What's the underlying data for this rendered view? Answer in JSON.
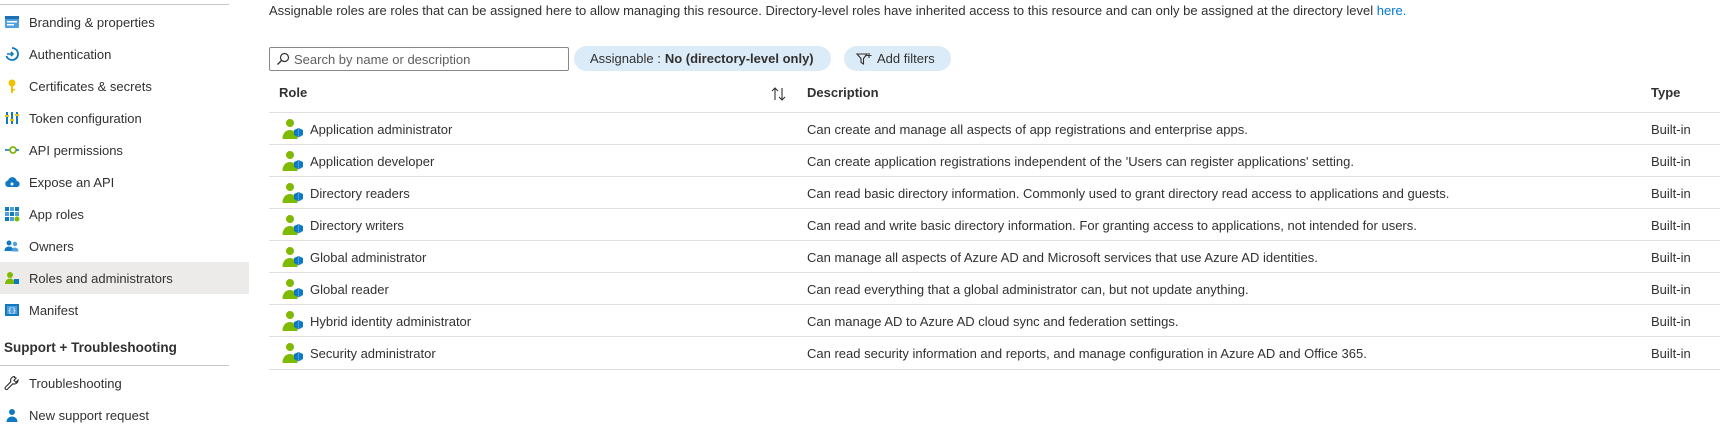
{
  "sidebar": {
    "items": [
      {
        "label": "Branding & properties",
        "icon": "branding-icon"
      },
      {
        "label": "Authentication",
        "icon": "authentication-icon"
      },
      {
        "label": "Certificates & secrets",
        "icon": "key-icon"
      },
      {
        "label": "Token configuration",
        "icon": "token-icon"
      },
      {
        "label": "API permissions",
        "icon": "api-permissions-icon"
      },
      {
        "label": "Expose an API",
        "icon": "cloud-icon"
      },
      {
        "label": "App roles",
        "icon": "app-roles-icon"
      },
      {
        "label": "Owners",
        "icon": "owners-icon"
      },
      {
        "label": "Roles and administrators",
        "icon": "roles-icon"
      },
      {
        "label": "Manifest",
        "icon": "manifest-icon"
      }
    ],
    "section_title": "Support + Troubleshooting",
    "support_items": [
      {
        "label": "Troubleshooting",
        "icon": "wrench-icon"
      },
      {
        "label": "New support request",
        "icon": "support-person-icon"
      }
    ],
    "active_index": 8
  },
  "intro": {
    "text": "Assignable roles are roles that can be assigned here to allow managing this resource. Directory-level roles have inherited access to this resource and can only be assigned at the directory level ",
    "link": "here."
  },
  "search": {
    "placeholder": "Search by name or description",
    "value": ""
  },
  "filter_pill": {
    "label": "Assignable :",
    "value": "No (directory-level only)"
  },
  "add_filters": {
    "label": "Add filters"
  },
  "table": {
    "headers": {
      "role": "Role",
      "description": "Description",
      "type": "Type"
    },
    "rows": [
      {
        "role": "Application administrator",
        "description": "Can create and manage all aspects of app registrations and enterprise apps.",
        "type": "Built-in"
      },
      {
        "role": "Application developer",
        "description": "Can create application registrations independent of the 'Users can register applications' setting.",
        "type": "Built-in"
      },
      {
        "role": "Directory readers",
        "description": "Can read basic directory information. Commonly used to grant directory read access to applications and guests.",
        "type": "Built-in"
      },
      {
        "role": "Directory writers",
        "description": "Can read and write basic directory information. For granting access to applications, not intended for users.",
        "type": "Built-in"
      },
      {
        "role": "Global administrator",
        "description": "Can manage all aspects of Azure AD and Microsoft services that use Azure AD identities.",
        "type": "Built-in"
      },
      {
        "role": "Global reader",
        "description": "Can read everything that a global administrator can, but not update anything.",
        "type": "Built-in"
      },
      {
        "role": "Hybrid identity administrator",
        "description": "Can manage AD to Azure AD cloud sync and federation settings.",
        "type": "Built-in"
      },
      {
        "role": "Security administrator",
        "description": "Can read security information and reports, and manage configuration in Azure AD and Office 365.",
        "type": "Built-in"
      }
    ]
  },
  "colors": {
    "accent": "#0078d4",
    "pill_bg": "#dcebf8",
    "active_bg": "#edebe9",
    "role_icon_green": "#7fba00"
  }
}
